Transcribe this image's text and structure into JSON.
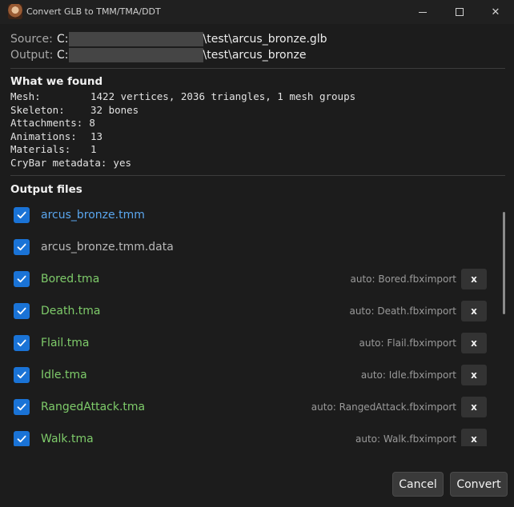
{
  "window": {
    "title": "Convert GLB to TMM/TMA/DDT",
    "minimize_glyph": "",
    "close_glyph": "✕"
  },
  "paths": {
    "source_label": "Source:",
    "source_prefix": "C:",
    "source_suffix": "\\test\\arcus_bronze.glb",
    "output_label": "Output:",
    "output_prefix": "C:",
    "output_suffix": "\\test\\arcus_bronze"
  },
  "found": {
    "title": "What we found",
    "rows": [
      {
        "key": "Mesh:",
        "value": "1422 vertices, 2036 triangles, 1 mesh groups"
      },
      {
        "key": "Skeleton:",
        "value": "32 bones"
      },
      {
        "key": "Attachments:",
        "value": "8"
      },
      {
        "key": "Animations:",
        "value": "13"
      },
      {
        "key": "Materials:",
        "value": "1"
      },
      {
        "key": "CryBar metadata:",
        "value": "yes"
      }
    ]
  },
  "output": {
    "title": "Output files",
    "files": [
      {
        "name": "arcus_bronze.tmm",
        "color": "#5aa6ee",
        "auto": "",
        "checked": true,
        "removable": false
      },
      {
        "name": "arcus_bronze.tmm.data",
        "color": "#b8b8b8",
        "auto": "",
        "checked": true,
        "removable": false
      },
      {
        "name": "Bored.tma",
        "color": "#7ecb6a",
        "auto": "auto: Bored.fbximport",
        "checked": true,
        "removable": true
      },
      {
        "name": "Death.tma",
        "color": "#7ecb6a",
        "auto": "auto: Death.fbximport",
        "checked": true,
        "removable": true
      },
      {
        "name": "Flail.tma",
        "color": "#7ecb6a",
        "auto": "auto: Flail.fbximport",
        "checked": true,
        "removable": true
      },
      {
        "name": "Idle.tma",
        "color": "#7ecb6a",
        "auto": "auto: Idle.fbximport",
        "checked": true,
        "removable": true
      },
      {
        "name": "RangedAttack.tma",
        "color": "#7ecb6a",
        "auto": "auto: RangedAttack.fbximport",
        "checked": true,
        "removable": true
      },
      {
        "name": "Walk.tma",
        "color": "#7ecb6a",
        "auto": "auto: Walk.fbximport",
        "checked": true,
        "removable": true
      }
    ],
    "remove_label": "x"
  },
  "buttons": {
    "cancel": "Cancel",
    "convert": "Convert"
  },
  "colors": {
    "accent": "#1a73d6",
    "tmm": "#5aa6ee",
    "tma": "#7ecb6a"
  }
}
